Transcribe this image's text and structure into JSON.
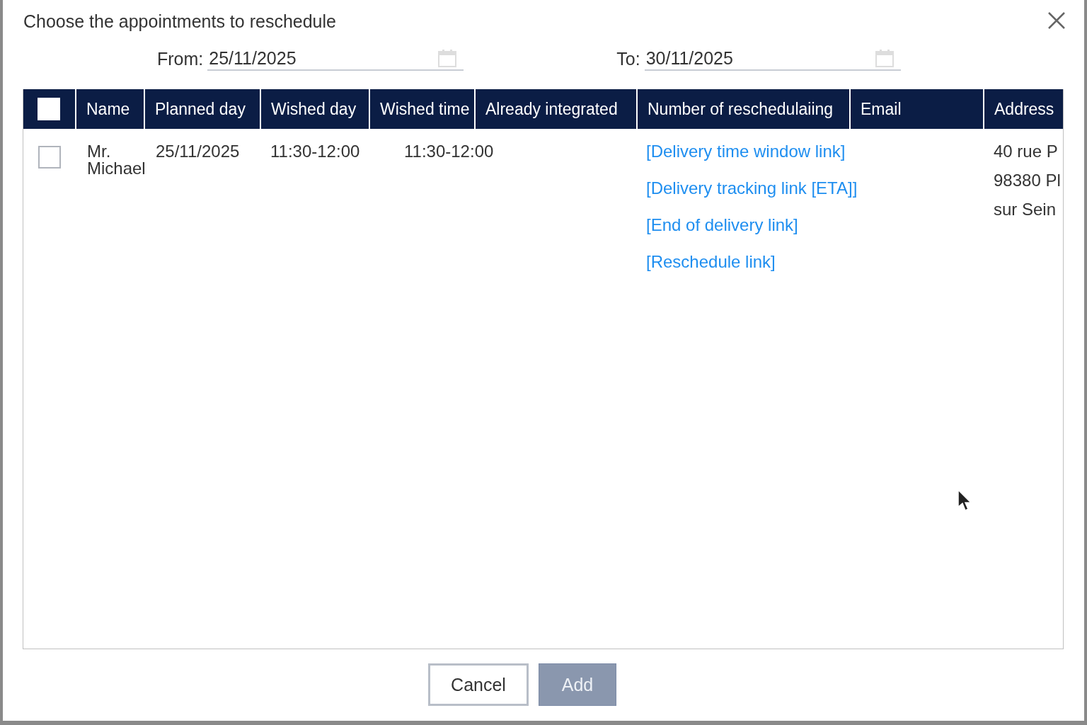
{
  "dialog": {
    "title": "Choose the appointments to reschedule"
  },
  "from": {
    "label": "From:",
    "value": "25/11/2025"
  },
  "to": {
    "label": "To:",
    "value": "30/11/2025"
  },
  "table": {
    "select_all": {
      "checked": false
    },
    "columns": [
      "Name",
      "Planned day",
      "Wished day",
      "Wished time",
      "Already integrated",
      "Number of reschedulaiing",
      "Email",
      "Address"
    ],
    "rows": [
      {
        "checked": false,
        "name": "Mr. Michael",
        "planned_day": "25/11/2025",
        "wished_day": "11:30-12:00",
        "wished_time": "11:30-12:00",
        "links": [
          "[Delivery time window link]",
          "[Delivery tracking link [ETA]]",
          "[End of delivery link]",
          "[Reschedule link]"
        ],
        "address": [
          "40 rue P",
          "98380 Pl",
          "sur Sein"
        ]
      }
    ]
  },
  "buttons": [
    {
      "label": "Cancel",
      "kind": "secondary"
    },
    {
      "label": "Add",
      "kind": "primary",
      "disabled": true
    }
  ]
}
